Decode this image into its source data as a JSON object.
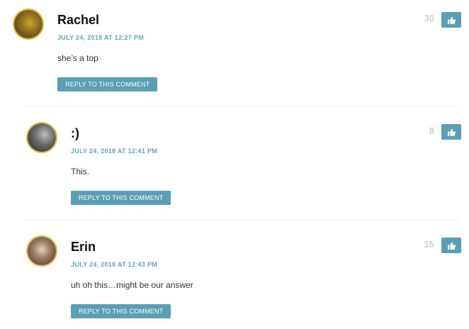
{
  "comments": [
    {
      "author": "Rachel",
      "date": "JULY 24, 2018 AT 12:27 PM",
      "text": "she’s a top",
      "reply_label": "REPLY TO THIS COMMENT",
      "score": "30"
    },
    {
      "author": ":)",
      "date": "JULY 24, 2018 AT 12:41 PM",
      "text": "This.",
      "reply_label": "REPLY TO THIS COMMENT",
      "score": "8"
    },
    {
      "author": "Erin",
      "date": "JULY 24, 2018 AT 12:43 PM",
      "text": "uh oh this…might be our answer",
      "reply_label": "REPLY TO THIS COMMENT",
      "score": "15"
    }
  ],
  "colors": {
    "accent": "#5a9fb5",
    "date": "#62a8bf",
    "avatar_ring": "#e7b93c",
    "score": "#c9d1d6"
  },
  "icons": {
    "like": "thumbs-up-icon"
  }
}
